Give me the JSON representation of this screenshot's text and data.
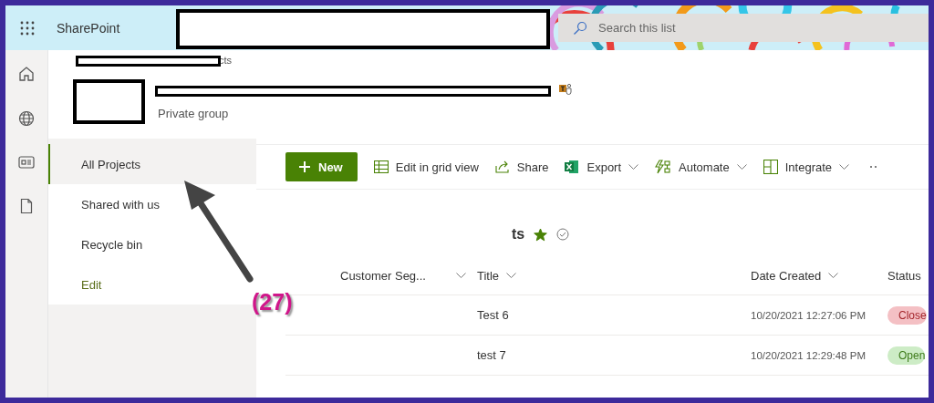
{
  "app_bar": {
    "app_name": "SharePoint",
    "search": {
      "placeholder": "Search this list"
    }
  },
  "site": {
    "breadcrumb": "cts",
    "subtitle": "Private group"
  },
  "nav": {
    "items": [
      {
        "label": "All Projects",
        "selected": true,
        "kind": "page"
      },
      {
        "label": "Shared with us",
        "selected": false,
        "kind": "page"
      },
      {
        "label": "Recycle bin",
        "selected": false,
        "kind": "page"
      },
      {
        "label": "Edit",
        "selected": false,
        "kind": "edit"
      }
    ]
  },
  "command_bar": [
    {
      "label": "New",
      "kind": "new",
      "dropdown": false
    },
    {
      "label": "Edit in grid view",
      "kind": "grid",
      "dropdown": false
    },
    {
      "label": "Share",
      "kind": "share",
      "dropdown": false
    },
    {
      "label": "Export",
      "kind": "export",
      "dropdown": true
    },
    {
      "label": "Automate",
      "kind": "automate",
      "dropdown": true
    },
    {
      "label": "Integrate",
      "kind": "integrate",
      "dropdown": true
    }
  ],
  "list": {
    "title": "ts",
    "favorite": true
  },
  "table": {
    "columns": [
      {
        "label": "Customer Seg...",
        "kind": "segment"
      },
      {
        "label": "Title",
        "kind": "title"
      },
      {
        "label": "Date Created",
        "kind": "date"
      },
      {
        "label": "Status",
        "kind": "status"
      }
    ],
    "rows": [
      {
        "title": "Test 6",
        "date_created": "10/20/2021 12:27:06 PM",
        "status": {
          "label": "Close",
          "kind": "closed"
        }
      },
      {
        "title": "test 7",
        "date_created": "10/20/2021 12:29:48 PM",
        "status": {
          "label": "Open",
          "kind": "open"
        }
      }
    ]
  },
  "annotation": {
    "label": "(27)"
  }
}
